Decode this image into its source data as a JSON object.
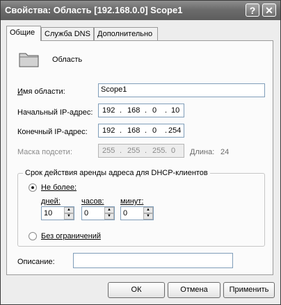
{
  "window": {
    "title": "Свойства: Область [192.168.0.0] Scope1",
    "help_glyph": "?",
    "close_glyph": "✕"
  },
  "tabs": [
    {
      "label": "Общие",
      "active": true
    },
    {
      "label": "Служба DNS",
      "active": false
    },
    {
      "label": "Дополнительно",
      "active": false
    }
  ],
  "general": {
    "icon": "folder-icon",
    "heading": "Область",
    "name_label": "Имя области:",
    "name_value": "Scope1",
    "start_ip_label": "Начальный IP-адрес:",
    "start_ip": [
      "192",
      "168",
      "0",
      "10"
    ],
    "end_ip_label": "Конечный IP-адрес:",
    "end_ip": [
      "192",
      "168",
      "0",
      "254"
    ],
    "mask_label": "Маска подсети:",
    "mask": [
      "255",
      "255",
      "255",
      "0"
    ],
    "length_label": "Длина:",
    "length_value": "24",
    "lease_group_title": "Срок действия аренды адреса для DHCP-клиентов",
    "limited_label": "Не более:",
    "limited_selected": true,
    "days_label": "дней:",
    "days_value": "10",
    "hours_label": "часов:",
    "hours_value": "0",
    "minutes_label": "минут:",
    "minutes_value": "0",
    "unlimited_label": "Без ограничений",
    "unlimited_selected": false,
    "description_label": "Описание:",
    "description_value": ""
  },
  "buttons": {
    "ok": "ОК",
    "cancel": "Отмена",
    "apply": "Применить"
  }
}
